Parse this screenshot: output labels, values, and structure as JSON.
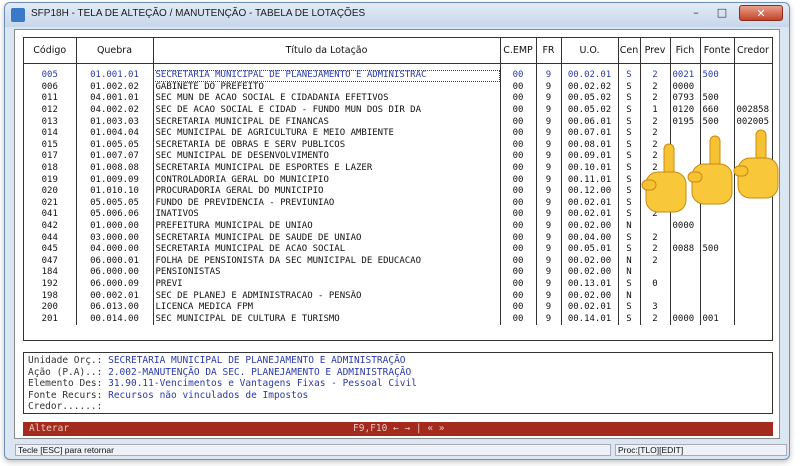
{
  "window": {
    "title": "SFP18H - TELA DE ALTEÇÃO / MANUTENÇÃO - TABELA DE LOTAÇÕES"
  },
  "table": {
    "headers": {
      "codigo": "Código",
      "quebra": "Quebra",
      "titulo": "Título da Lotação",
      "cemp": "C.EMP",
      "fr": "FR",
      "uo": "U.O.",
      "cen": "Cen",
      "prev": "Prev",
      "fich": "Fich",
      "fonte": "Fonte",
      "credor": "Credor"
    },
    "rows": [
      {
        "codigo": "005",
        "quebra": "01.001.01",
        "titulo": "SECRETARIA MUNICIPAL DE PLANEJAMENTO E ADMINISTRAC",
        "cemp": "00",
        "fr": "9",
        "uo": "00.02.01",
        "cen": "S",
        "prev": "2",
        "fich": "0021",
        "fonte": "500",
        "credor": ""
      },
      {
        "codigo": "006",
        "quebra": "01.002.02",
        "titulo": "GABINETE DO PREFEITO",
        "cemp": "00",
        "fr": "9",
        "uo": "00.02.02",
        "cen": "S",
        "prev": "2",
        "fich": "0000",
        "fonte": "",
        "credor": ""
      },
      {
        "codigo": "011",
        "quebra": "04.001.01",
        "titulo": "SEC MUN DE ACAO SOCIAL E CIDADANIA EFETIVOS",
        "cemp": "00",
        "fr": "9",
        "uo": "00.05.02",
        "cen": "S",
        "prev": "2",
        "fich": "0793",
        "fonte": "500",
        "credor": ""
      },
      {
        "codigo": "012",
        "quebra": "04.002.02",
        "titulo": "SEC DE ACAO SOCIAL E CIDAD - FUNDO MUN DOS DIR DA",
        "cemp": "00",
        "fr": "9",
        "uo": "00.05.02",
        "cen": "S",
        "prev": "1",
        "fich": "0120",
        "fonte": "660",
        "credor": "002858"
      },
      {
        "codigo": "013",
        "quebra": "01.003.03",
        "titulo": "SECRETARIA MUNICIPAL DE FINANCAS",
        "cemp": "00",
        "fr": "9",
        "uo": "00.06.01",
        "cen": "S",
        "prev": "2",
        "fich": "0195",
        "fonte": "500",
        "credor": "002005"
      },
      {
        "codigo": "014",
        "quebra": "01.004.04",
        "titulo": "SEC MUNICIPAL DE AGRICULTURA E MEIO AMBIENTE",
        "cemp": "00",
        "fr": "9",
        "uo": "00.07.01",
        "cen": "S",
        "prev": "2",
        "fich": "",
        "fonte": "",
        "credor": ""
      },
      {
        "codigo": "015",
        "quebra": "01.005.05",
        "titulo": "SECRETARIA DE OBRAS E SERV PUBLICOS",
        "cemp": "00",
        "fr": "9",
        "uo": "00.08.01",
        "cen": "S",
        "prev": "2",
        "fich": "",
        "fonte": "",
        "credor": ""
      },
      {
        "codigo": "017",
        "quebra": "01.007.07",
        "titulo": "SEC MUNICIPAL DE DESENVOLVIMENTO",
        "cemp": "00",
        "fr": "9",
        "uo": "00.09.01",
        "cen": "S",
        "prev": "2",
        "fich": "",
        "fonte": "",
        "credor": ""
      },
      {
        "codigo": "018",
        "quebra": "01.008.08",
        "titulo": "SECRETARIA MUNICIPAL DE ESPORTES E LAZER",
        "cemp": "00",
        "fr": "9",
        "uo": "00.10.01",
        "cen": "S",
        "prev": "2",
        "fich": "",
        "fonte": "",
        "credor": ""
      },
      {
        "codigo": "019",
        "quebra": "01.009.09",
        "titulo": "CONTROLADORIA GERAL DO MUNICIPIO",
        "cemp": "00",
        "fr": "9",
        "uo": "00.11.01",
        "cen": "S",
        "prev": "2",
        "fich": "",
        "fonte": "",
        "credor": ""
      },
      {
        "codigo": "020",
        "quebra": "01.010.10",
        "titulo": "PROCURADORIA GERAL DO MUNICIPIO",
        "cemp": "00",
        "fr": "9",
        "uo": "00.12.00",
        "cen": "S",
        "prev": "2",
        "fich": "",
        "fonte": "",
        "credor": ""
      },
      {
        "codigo": "021",
        "quebra": "05.005.05",
        "titulo": "FUNDO DE PREVIDENCIA - PREVIUNIAO",
        "cemp": "00",
        "fr": "9",
        "uo": "00.02.01",
        "cen": "S",
        "prev": "2",
        "fich": "",
        "fonte": "",
        "credor": ""
      },
      {
        "codigo": "041",
        "quebra": "05.006.06",
        "titulo": "INATIVOS",
        "cemp": "00",
        "fr": "9",
        "uo": "00.02.01",
        "cen": "S",
        "prev": "2",
        "fich": "",
        "fonte": "",
        "credor": ""
      },
      {
        "codigo": "042",
        "quebra": "01.000.00",
        "titulo": "PREFEITURA MUNICIPAL DE UNIAO",
        "cemp": "00",
        "fr": "9",
        "uo": "00.02.00",
        "cen": "N",
        "prev": "",
        "fich": "0000",
        "fonte": "",
        "credor": ""
      },
      {
        "codigo": "044",
        "quebra": "03.000.00",
        "titulo": "SECRETARIA MUNICIPAL DE SAUDE DE UNIAO",
        "cemp": "00",
        "fr": "9",
        "uo": "00.04.00",
        "cen": "S",
        "prev": "2",
        "fich": "",
        "fonte": "",
        "credor": ""
      },
      {
        "codigo": "045",
        "quebra": "04.000.00",
        "titulo": "SECRETARIA MUNICIPAL DE ACAO SOCIAL",
        "cemp": "00",
        "fr": "9",
        "uo": "00.05.01",
        "cen": "S",
        "prev": "2",
        "fich": "0088",
        "fonte": "500",
        "credor": ""
      },
      {
        "codigo": "047",
        "quebra": "06.000.01",
        "titulo": "FOLHA DE PENSIONISTA DA SEC MUNICIPAL DE EDUCACAO",
        "cemp": "00",
        "fr": "9",
        "uo": "00.02.00",
        "cen": "N",
        "prev": "2",
        "fich": "",
        "fonte": "",
        "credor": ""
      },
      {
        "codigo": "184",
        "quebra": "06.000.00",
        "titulo": "PENSIONISTAS",
        "cemp": "00",
        "fr": "9",
        "uo": "00.02.00",
        "cen": "N",
        "prev": "",
        "fich": "",
        "fonte": "",
        "credor": ""
      },
      {
        "codigo": "192",
        "quebra": "06.000.09",
        "titulo": "PREVI",
        "cemp": "00",
        "fr": "9",
        "uo": "00.13.01",
        "cen": "S",
        "prev": "0",
        "fich": "",
        "fonte": "",
        "credor": ""
      },
      {
        "codigo": "198",
        "quebra": "00.002.01",
        "titulo": "SEC DE PLANEJ E ADMINISTRACAO - PENSÃO",
        "cemp": "00",
        "fr": "9",
        "uo": "00.02.00",
        "cen": "N",
        "prev": "",
        "fich": "",
        "fonte": "",
        "credor": ""
      },
      {
        "codigo": "200",
        "quebra": "06.013.00",
        "titulo": "LICENCA MEDICA FPM",
        "cemp": "00",
        "fr": "9",
        "uo": "00.02.01",
        "cen": "S",
        "prev": "3",
        "fich": "",
        "fonte": "",
        "credor": ""
      },
      {
        "codigo": "201",
        "quebra": "00.014.00",
        "titulo": "SEC MUNICIPAL DE CULTURA E TURISMO",
        "cemp": "00",
        "fr": "9",
        "uo": "00.14.01",
        "cen": "S",
        "prev": "2",
        "fich": "0000",
        "fonte": "001",
        "credor": ""
      }
    ]
  },
  "info": {
    "unidade_label": "Unidade Orç.:",
    "unidade_value": "SECRETARIA MUNICIPAL DE PLANEJAMENTO E ADMINISTRAÇÃO",
    "acao_label": "Ação (P.A)..:",
    "acao_value": "2.002-MANUTENÇÃO DA SEC. PLANEJAMENTO E ADMINISTRAÇÃO",
    "elemento_label": "Elemento Des:",
    "elemento_value": "31.90.11-Vencimentos e Vantagens Fixas - Pessoal Civil",
    "fonte_label": "Fonte Recurs:",
    "fonte_value": "Recursos não vinculados de Impostos",
    "credor_label": "Credor......:",
    "credor_value": ""
  },
  "actionbar": {
    "mode": "Alterar",
    "keys": "F9,F10 ← → | « »"
  },
  "statusbar": {
    "left": "Tecle [ESC] para retornar",
    "right": "Proc:[TLO][EDIT]"
  },
  "colors": {
    "actionbar_bg": "#a32a1c",
    "selected_text": "#2a3aa8",
    "close_button": "#c4422a"
  },
  "icons": {
    "overlay": "pointing-hands-icon"
  }
}
